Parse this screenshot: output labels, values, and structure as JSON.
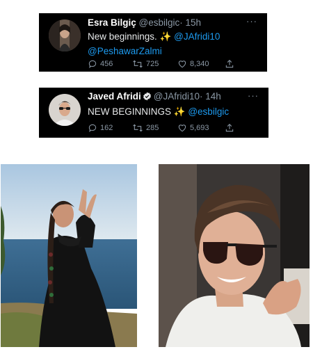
{
  "tweets": [
    {
      "display_name": "Esra Bilgiç",
      "handle": "@esbilgic",
      "time": "· 15h",
      "text": "New beginnings. ✨",
      "mention1": "@JAfridi10",
      "mention2": "@PeshawarZalmi",
      "replies": "456",
      "retweets": "725",
      "likes": "8,340",
      "more": "···"
    },
    {
      "display_name": "Javed Afridi",
      "handle": "@JAfridi10",
      "time": "· 14h",
      "text": "NEW BEGINNINGS ✨",
      "mention1": "@esbilgic",
      "replies": "162",
      "retweets": "285",
      "likes": "5,693",
      "more": "···"
    }
  ],
  "colors": {
    "tweet_bg": "#000000",
    "link": "#1d9bf0",
    "muted": "#8b98a5",
    "verified": "#1d9bf0"
  },
  "icons": [
    "reply-icon",
    "retweet-icon",
    "like-icon",
    "share-icon",
    "verified-badge-icon",
    "more-icon"
  ]
}
